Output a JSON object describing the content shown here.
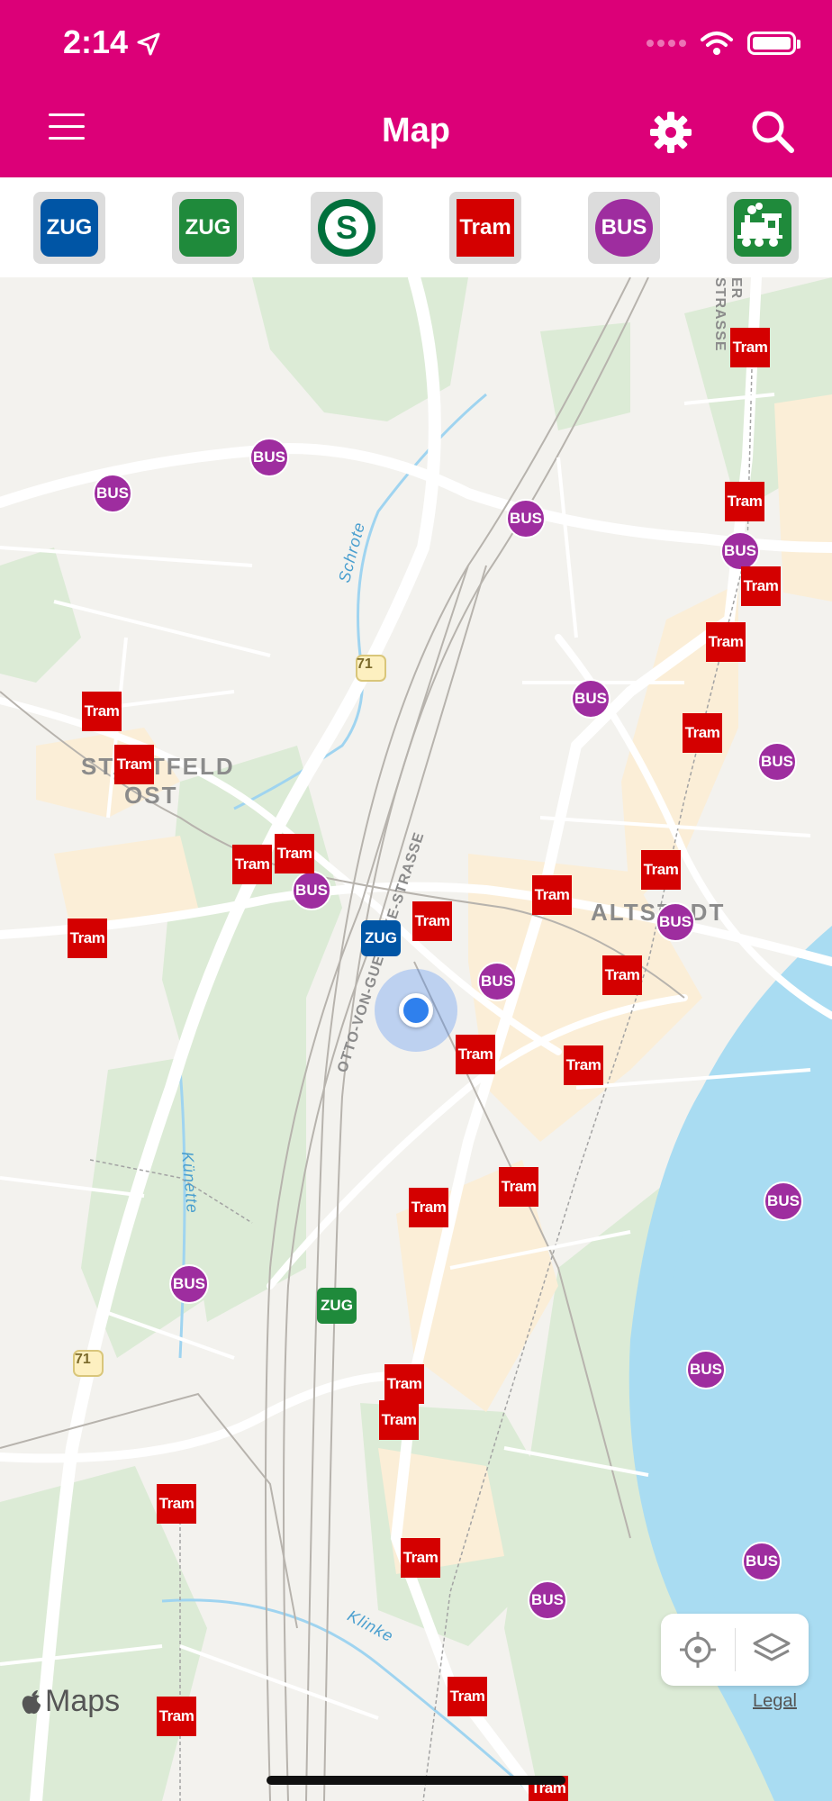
{
  "status_bar": {
    "time": "2:14"
  },
  "header": {
    "title": "Map",
    "bg_color": "#dc0078"
  },
  "filters": [
    {
      "label": "ZUG",
      "name": "filter-zug-blue",
      "color": "#0055a5"
    },
    {
      "label": "ZUG",
      "name": "filter-zug-green",
      "color": "#1f8a3b"
    },
    {
      "label": "S",
      "name": "filter-sbahn",
      "color": "#00703c"
    },
    {
      "label": "Tram",
      "name": "filter-tram",
      "color": "#d40000"
    },
    {
      "label": "BUS",
      "name": "filter-bus",
      "color": "#9e2d9f"
    },
    {
      "label": "steam-train-icon",
      "name": "filter-heritage-train",
      "color": "#1f8a3b"
    }
  ],
  "map": {
    "labels": {
      "district_1": "STADTFELD",
      "district_1b": "OST",
      "district_2": "ALTSTADT",
      "street": "OTTO-VON-GUERICKE-STRASSE",
      "street_2": "ER STRASSE",
      "river_1": "Schrote",
      "river_2": "Künette",
      "river_3": "Klinke",
      "road_71": "71"
    },
    "tram_label": "Tram",
    "bus_label": "BUS",
    "zug_label": "ZUG",
    "maps_brand": "Maps",
    "legal": "Legal"
  }
}
